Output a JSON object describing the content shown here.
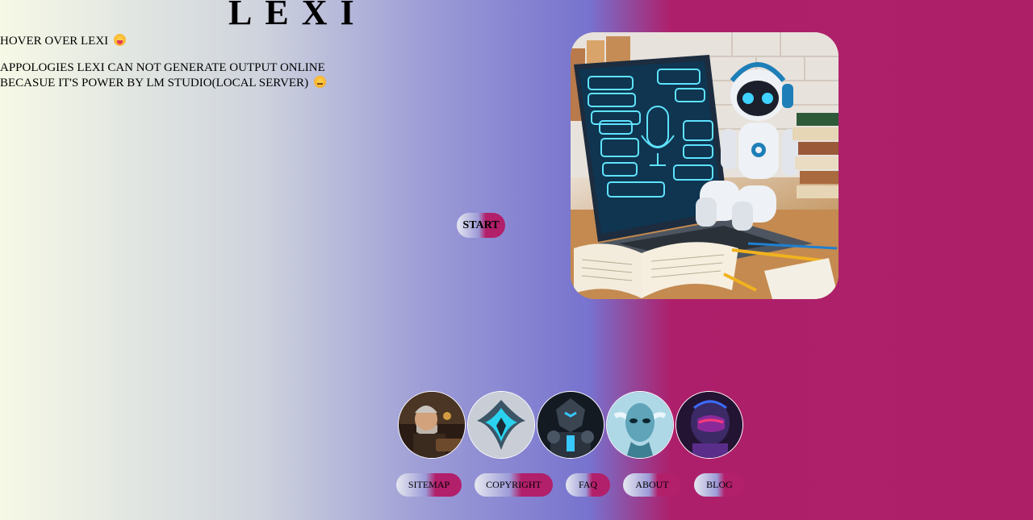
{
  "header": {
    "title": "LEXI"
  },
  "intro": {
    "hover_text": "HOVER OVER LEXI",
    "hover_emoji": "tongue-face-icon",
    "apology_text": "APPOLOGIES LEXI CAN NOT GENERATE OUTPUT ONLINE BECASUE IT'S POWER BY LM STUDIO(LOCAL SERVER)",
    "apology_emoji": "smirk-face-icon"
  },
  "main": {
    "start_label": "START",
    "hero_image": "robot-with-laptop-illustration"
  },
  "avatars": [
    {
      "name": "avatar-old-man-typewriter"
    },
    {
      "name": "avatar-cyan-emblem"
    },
    {
      "name": "avatar-dark-robot"
    },
    {
      "name": "avatar-blue-alien"
    },
    {
      "name": "avatar-neon-helmet"
    }
  ],
  "footer": {
    "links": [
      {
        "label": "SITEMAP"
      },
      {
        "label": "COPYRIGHT"
      },
      {
        "label": "FAQ"
      },
      {
        "label": "ABOUT"
      },
      {
        "label": "BLOG"
      }
    ]
  },
  "colors": {
    "gradient_left": "#f6f9e6",
    "gradient_mid": "#7b78cf",
    "gradient_right": "#ad2068"
  }
}
